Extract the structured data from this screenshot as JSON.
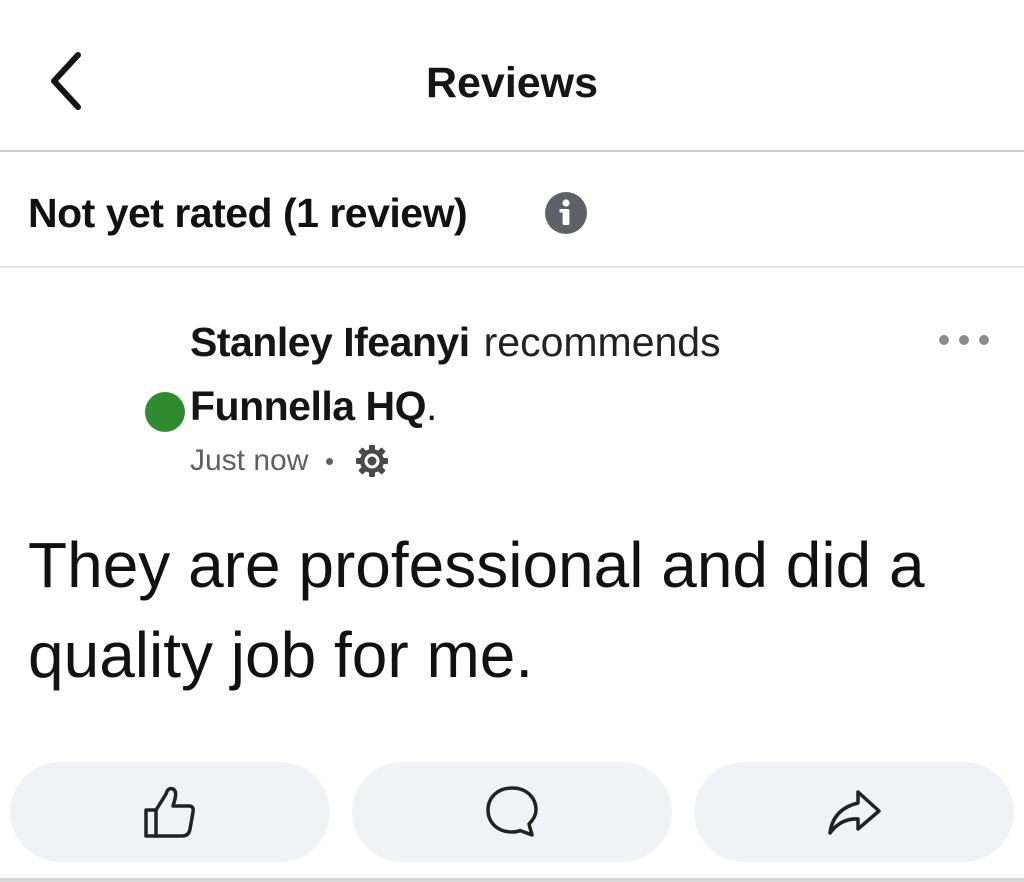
{
  "header": {
    "title": "Reviews",
    "back_icon": "chevron-left-icon"
  },
  "rating": {
    "summary": "Not yet rated (1 review)",
    "info_icon": "info-icon"
  },
  "review": {
    "author": "Stanley Ifeanyi",
    "verb": "recommends",
    "page_name": "Funnella HQ",
    "page_suffix": ".",
    "timestamp": "Just now",
    "privacy_icon": "public-gear-icon",
    "body": "They are professional and did a quality job for me.",
    "status_color": "#2e8b2e"
  },
  "actions": {
    "like_icon": "thumbs-up-icon",
    "comment_icon": "comment-icon",
    "share_icon": "share-icon"
  }
}
